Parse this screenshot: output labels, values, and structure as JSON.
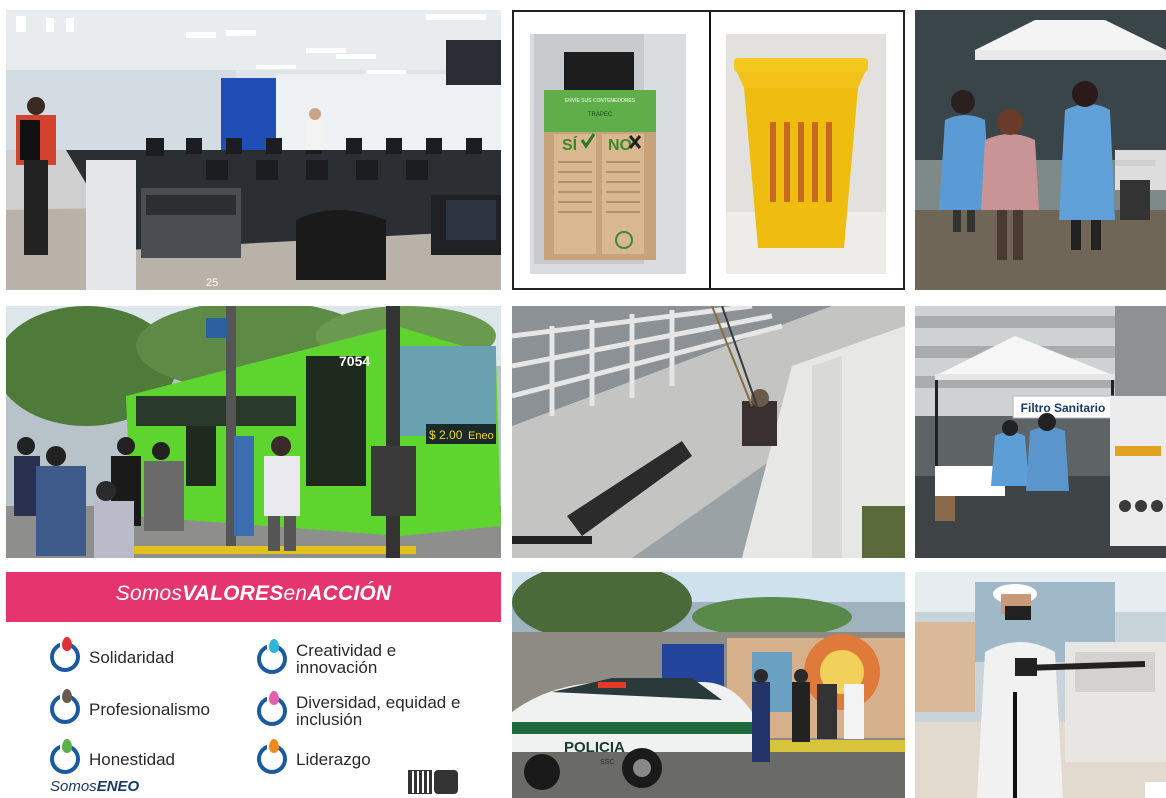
{
  "photos": {
    "computer_lab": {
      "monitor_number": "25"
    },
    "bins": {
      "box_header": "ENVÍE SUS CONTENEDORES",
      "box_brand": "TRAPEC",
      "yes_label": "SÍ",
      "no_label": "NO"
    },
    "bus": {
      "fleet_number": "7054",
      "fare_display": "$ 2.00",
      "route_name": "Eneo"
    },
    "tent": {
      "sign_text": "Filtro Sanitario"
    },
    "police": {
      "car_text": "POLICIA",
      "car_subtext": "SSC"
    }
  },
  "values_card": {
    "banner_prefix": "Somos",
    "banner_bold_1": "VALORES",
    "banner_mid": "en",
    "banner_bold_2": "ACCIÓN",
    "values": [
      {
        "label": "Solidaridad",
        "color": "#e0303a"
      },
      {
        "label": "Creatividad e innovación",
        "color": "#2ab7d9"
      },
      {
        "label": "Profesionalismo",
        "color": "#6b5a4c"
      },
      {
        "label": "Diversidad, equidad e inclusión",
        "color": "#e45fb0"
      },
      {
        "label": "Honestidad",
        "color": "#5ab04a"
      },
      {
        "label": "Liderazgo",
        "color": "#f08a1c"
      }
    ],
    "footer_prefix": "Somos",
    "footer_bold": "ENEO"
  },
  "colors": {
    "banner": "#e6346f",
    "icon_ring": "#1a5aa0",
    "bus_green": "#5ed52e"
  }
}
